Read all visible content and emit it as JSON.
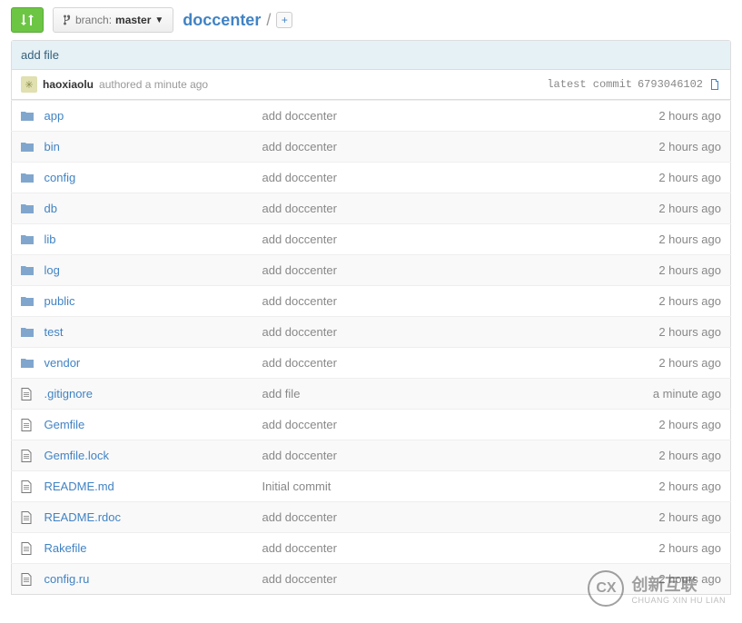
{
  "toolbar": {
    "branch_label": "branch:",
    "branch_name": "master"
  },
  "breadcrumb": {
    "repo": "doccenter",
    "sep": "/"
  },
  "commit": {
    "title": "add file",
    "author": "haoxiaolu",
    "authored_text": "authored a minute ago",
    "latest_commit_label": "latest commit",
    "sha": "6793046102"
  },
  "files": [
    {
      "type": "dir",
      "name": "app",
      "msg": "add doccenter",
      "time": "2 hours ago"
    },
    {
      "type": "dir",
      "name": "bin",
      "msg": "add doccenter",
      "time": "2 hours ago"
    },
    {
      "type": "dir",
      "name": "config",
      "msg": "add doccenter",
      "time": "2 hours ago"
    },
    {
      "type": "dir",
      "name": "db",
      "msg": "add doccenter",
      "time": "2 hours ago"
    },
    {
      "type": "dir",
      "name": "lib",
      "msg": "add doccenter",
      "time": "2 hours ago"
    },
    {
      "type": "dir",
      "name": "log",
      "msg": "add doccenter",
      "time": "2 hours ago"
    },
    {
      "type": "dir",
      "name": "public",
      "msg": "add doccenter",
      "time": "2 hours ago"
    },
    {
      "type": "dir",
      "name": "test",
      "msg": "add doccenter",
      "time": "2 hours ago"
    },
    {
      "type": "dir",
      "name": "vendor",
      "msg": "add doccenter",
      "time": "2 hours ago"
    },
    {
      "type": "file",
      "name": ".gitignore",
      "msg": "add file",
      "time": "a minute ago"
    },
    {
      "type": "file",
      "name": "Gemfile",
      "msg": "add doccenter",
      "time": "2 hours ago"
    },
    {
      "type": "file",
      "name": "Gemfile.lock",
      "msg": "add doccenter",
      "time": "2 hours ago"
    },
    {
      "type": "file",
      "name": "README.md",
      "msg": "Initial commit",
      "time": "2 hours ago"
    },
    {
      "type": "file",
      "name": "README.rdoc",
      "msg": "add doccenter",
      "time": "2 hours ago"
    },
    {
      "type": "file",
      "name": "Rakefile",
      "msg": "add doccenter",
      "time": "2 hours ago"
    },
    {
      "type": "file",
      "name": "config.ru",
      "msg": "add doccenter",
      "time": "2 hours ago"
    }
  ],
  "watermark": {
    "main": "创新互联",
    "sub": "CHUANG XIN HU LIAN"
  }
}
